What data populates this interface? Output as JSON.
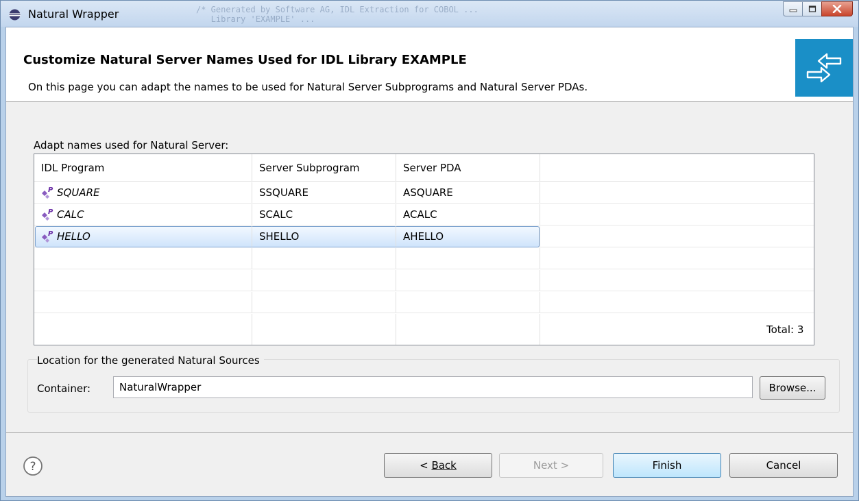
{
  "window": {
    "title": "Natural Wrapper",
    "background_text": "/* Generated by Software AG, IDL Extraction for COBOL ...\n   Library 'EXAMPLE' ..."
  },
  "header": {
    "title": "Customize Natural Server Names Used for IDL Library EXAMPLE",
    "description": "On this page you can adapt the names to be used for Natural Server Subprograms and Natural Server PDAs.",
    "icon": "wizard-banner-arrows-icon"
  },
  "table": {
    "label": "Adapt names used for Natural Server:",
    "columns": [
      "IDL Program",
      "Server Subprogram",
      "Server PDA"
    ],
    "rows": [
      {
        "program": "SQUARE",
        "subprogram": "SSQUARE",
        "pda": "ASQUARE"
      },
      {
        "program": "CALC",
        "subprogram": "SCALC",
        "pda": "ACALC"
      },
      {
        "program": "HELLO",
        "subprogram": "SHELLO",
        "pda": "AHELLO"
      }
    ],
    "selected_row": 2,
    "total": "Total: 3"
  },
  "location": {
    "group_title": "Location for the generated Natural Sources",
    "container_label": "Container:",
    "container_value": "NaturalWrapper",
    "browse_label": "Browse..."
  },
  "buttons": {
    "back": "Back",
    "next": "Next >",
    "finish": "Finish",
    "cancel": "Cancel"
  },
  "colors": {
    "banner": "#1a8fc7",
    "program_icon": "#8a5cc0",
    "selection": "#cfe4fb"
  }
}
